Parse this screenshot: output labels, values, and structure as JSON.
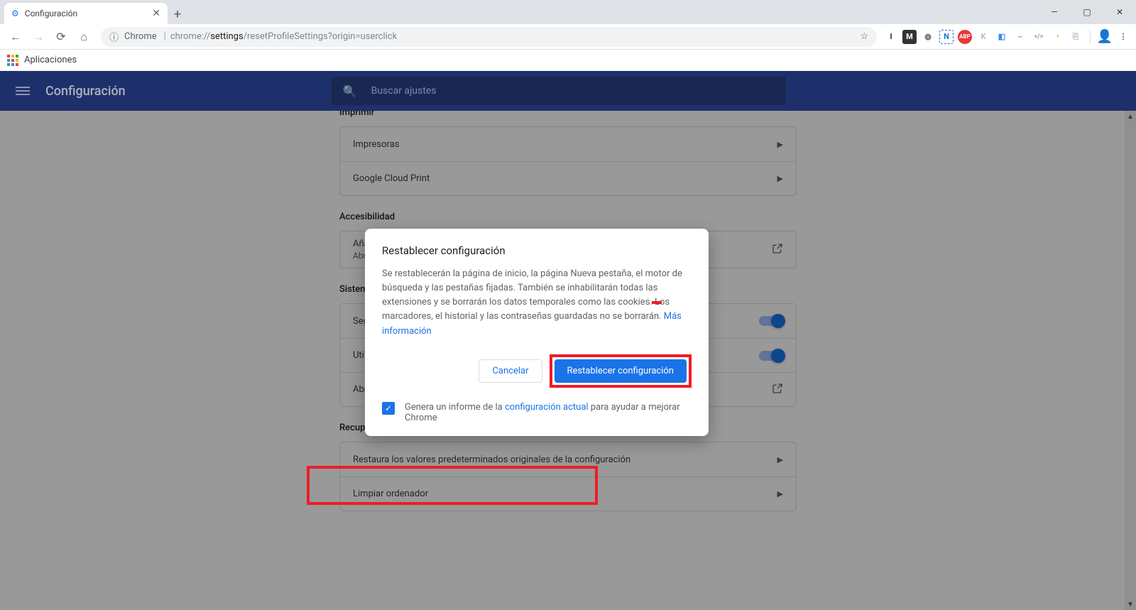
{
  "browser": {
    "tab_title": "Configuración",
    "new_tab": "+",
    "omnibox": {
      "secure_label": "Chrome",
      "url_prefix": "chrome://",
      "url_highlight": "settings",
      "url_suffix": "/resetProfileSettings?origin=userclick"
    },
    "bookmarks": {
      "apps_label": "Aplicaciones"
    },
    "window_controls": {
      "minimize": "—",
      "maximize": "▢",
      "close": "✕"
    }
  },
  "settings": {
    "app_title": "Configuración",
    "search_placeholder": "Buscar ajustes",
    "sections": {
      "print": {
        "title": "Imprimir",
        "items": [
          "Impresoras",
          "Google Cloud Print"
        ]
      },
      "accessibility": {
        "title": "Accesibilidad",
        "item_main": "Añadir funciones de accesibilidad",
        "item_sub": "Abrir Chrome Web Store"
      },
      "system": {
        "title": "Sistema",
        "items": [
          "Seguir ejecutando aplicaciones en segundo plano al cerrar Google Chrome",
          "Utilizar aceleración por hardware cuando esté disponible",
          "Abrir la configuración de proxy de tu ordenador"
        ]
      },
      "reset": {
        "title": "Recuperar ajustes y borrar",
        "items": [
          "Restaura los valores predeterminados originales de la configuración",
          "Limpiar ordenador"
        ]
      }
    }
  },
  "dialog": {
    "title": "Restablecer configuración",
    "body": "Se restablecerán la página de inicio, la página Nueva pestaña, el motor de búsqueda y las pestañas fijadas. También se inhabilitarán todas las extensiones y se borrarán los datos temporales como las cookies. Los marcadores, el historial y las contraseñas guardadas no se borrarán.",
    "more_info": "Más información",
    "cancel": "Cancelar",
    "confirm": "Restablecer configuración",
    "report_prefix": "Genera un informe de la ",
    "report_link": "configuración actual",
    "report_suffix": " para ayudar a mejorar Chrome"
  },
  "ext_icons": [
    "I",
    "M",
    "◍",
    "N",
    "ABP",
    "K",
    "◧",
    "~",
    "</>",
    "◔",
    "⎘"
  ],
  "colors": {
    "accent": "#1a73e8",
    "header": "#29418f",
    "highlight": "#ee1c25"
  }
}
